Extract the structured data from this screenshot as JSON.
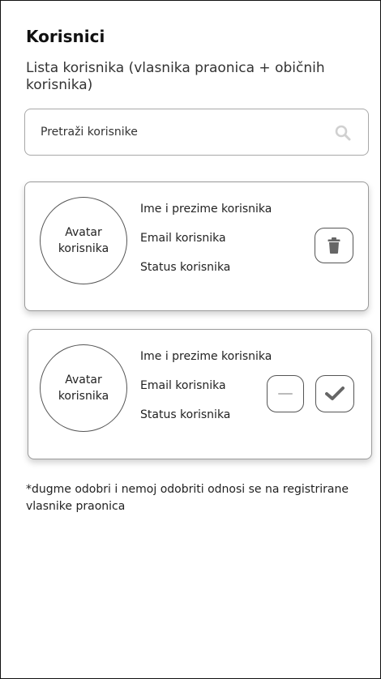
{
  "page": {
    "title": "Korisnici",
    "subtitle": "Lista korisnika (vlasnika praonica + običnih korisnika)"
  },
  "search": {
    "placeholder": "Pretraži korisnike",
    "icon": "search-icon"
  },
  "users": [
    {
      "avatar_label": "Avatar korisnika",
      "name": "Ime i prezime korisnika",
      "email": "Email korisnika",
      "status": "Status korisnika",
      "actions": [
        "delete"
      ]
    },
    {
      "avatar_label": "Avatar korisnika",
      "name": "Ime i prezime korisnika",
      "email": "Email korisnika",
      "status": "Status korisnika",
      "actions": [
        "reject",
        "approve"
      ]
    }
  ],
  "note": "*dugme odobri i nemoj odobriti odnosi se na registrirane vlasnike praonica",
  "colors": {
    "icon": "#666666",
    "border": "#9a9a9a",
    "search_icon": "#d0d0d0"
  }
}
